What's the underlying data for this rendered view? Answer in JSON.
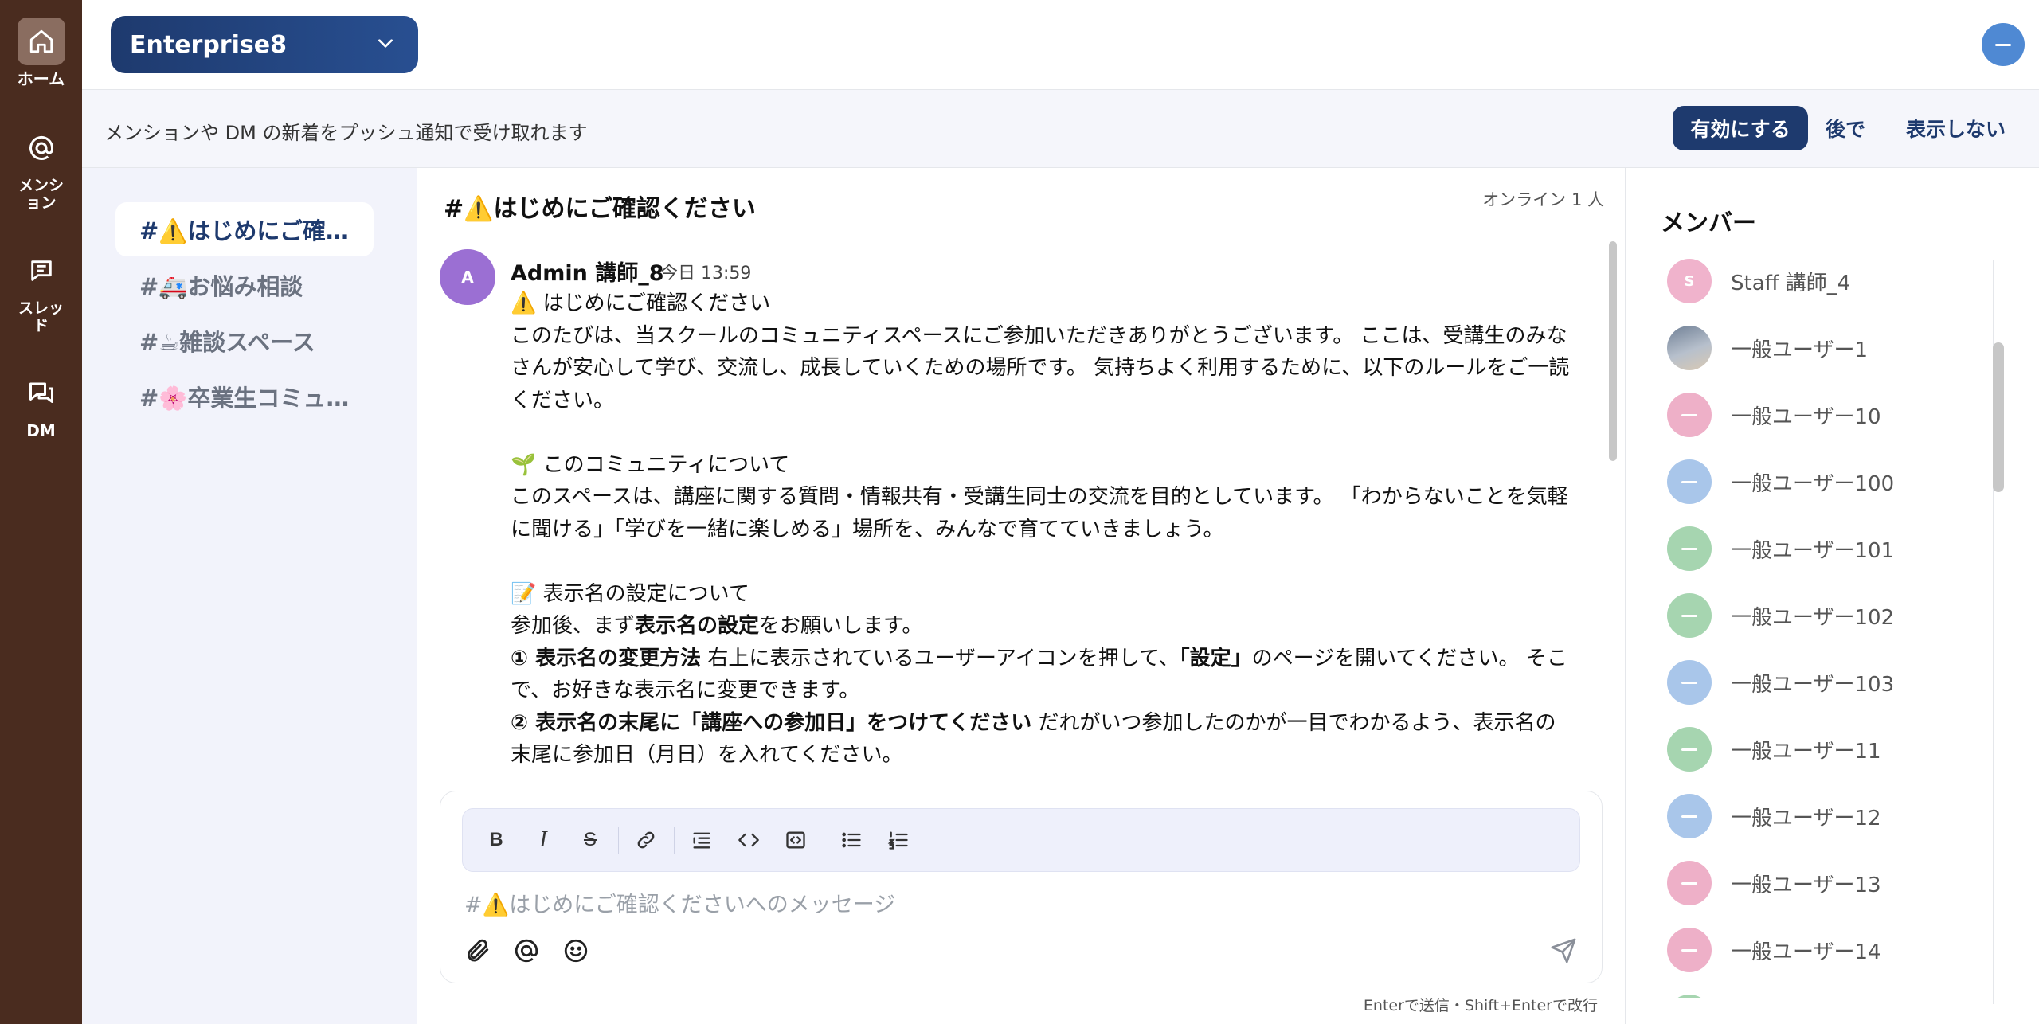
{
  "rail": {
    "items": [
      {
        "label": "ホーム",
        "icon": "home-icon",
        "active": true
      },
      {
        "label": "メンション",
        "icon": "at-icon",
        "active": false
      },
      {
        "label": "スレッド",
        "icon": "thread-icon",
        "active": false
      },
      {
        "label": "DM",
        "icon": "dm-icon",
        "active": false
      }
    ]
  },
  "header": {
    "workspace": "Enterprise8"
  },
  "notification": {
    "text": "メンションや DM の新着をプッシュ通知で受け取れます",
    "enable": "有効にする",
    "later": "後で",
    "hide": "表示しない"
  },
  "channels": [
    {
      "label": "#⚠️はじめにご確…",
      "active": true
    },
    {
      "label": "#🚑お悩み相談",
      "active": false
    },
    {
      "label": "#☕雑談スペース",
      "active": false
    },
    {
      "label": "#🌸卒業生コミュ…",
      "active": false
    }
  ],
  "main": {
    "title": "#⚠️はじめにご確認ください",
    "online": "オンライン 1 人"
  },
  "message": {
    "avatar": "A",
    "author": "Admin 講師_8",
    "time": "今日 13:59",
    "l1": "⚠️ はじめにご確認ください",
    "l2": "このたびは、当スクールのコミュニティスペースにご参加いただきありがとうございます。 ここは、受講生のみな",
    "l3": "さんが安心して学び、交流し、成長していくための場所です。 気持ちよく利用するために、以下のルールをご一読",
    "l4": "ください。",
    "l5": "🌱 このコミュニティについて",
    "l6": "このスペースは、講座に関する質問・情報共有・受講生同士の交流を目的としています。 「わからないことを気軽",
    "l7": "に聞ける」「学びを一緒に楽しめる」場所を、みんなで育てていきましょう。",
    "l8": "📝 表示名の設定について",
    "l9a": "参加後、まず",
    "l9b": "表示名の設定",
    "l9c": "をお願いします。",
    "l10a": "① 表示名の変更方法",
    "l10b": " 右上に表示されているユーザーアイコンを押して、",
    "l10c": "「設定」",
    "l10d": "のページを開いてください。 そこ",
    "l11": "で、お好きな表示名に変更できます。",
    "l12a": "② 表示名の末尾に「講座への参加日」をつけてください",
    "l12b": " だれがいつ参加したのかが一目でわかるよう、表示名の",
    "l13": "末尾に参加日（月日）を入れてください。"
  },
  "composer": {
    "placeholder": "#⚠️はじめにご確認くださいへのメッセージ",
    "hint": "Enterで送信・Shift+Enterで改行"
  },
  "members": {
    "title": "メンバー",
    "list": [
      {
        "name": "Staff 講師_4",
        "avatar": "S",
        "color": "#f0b3cc"
      },
      {
        "name": "一般ユーザー1",
        "avatar": "",
        "color": "#9aa7b8"
      },
      {
        "name": "一般ユーザー10",
        "avatar": "",
        "color": "#eeb0c8"
      },
      {
        "name": "一般ユーザー100",
        "avatar": "",
        "color": "#a9c6ea"
      },
      {
        "name": "一般ユーザー101",
        "avatar": "",
        "color": "#a6d5b0"
      },
      {
        "name": "一般ユーザー102",
        "avatar": "",
        "color": "#a6d5b0"
      },
      {
        "name": "一般ユーザー103",
        "avatar": "",
        "color": "#a9c6ea"
      },
      {
        "name": "一般ユーザー11",
        "avatar": "",
        "color": "#a6d5b0"
      },
      {
        "name": "一般ユーザー12",
        "avatar": "",
        "color": "#a9c6ea"
      },
      {
        "name": "一般ユーザー13",
        "avatar": "",
        "color": "#eeb0c8"
      },
      {
        "name": "一般ユーザー14",
        "avatar": "",
        "color": "#eeb0c8"
      }
    ]
  },
  "colors": {
    "rail": "#4a2c1f",
    "accent": "#1e3a6e",
    "channel_bg": "#f2f3fb"
  }
}
